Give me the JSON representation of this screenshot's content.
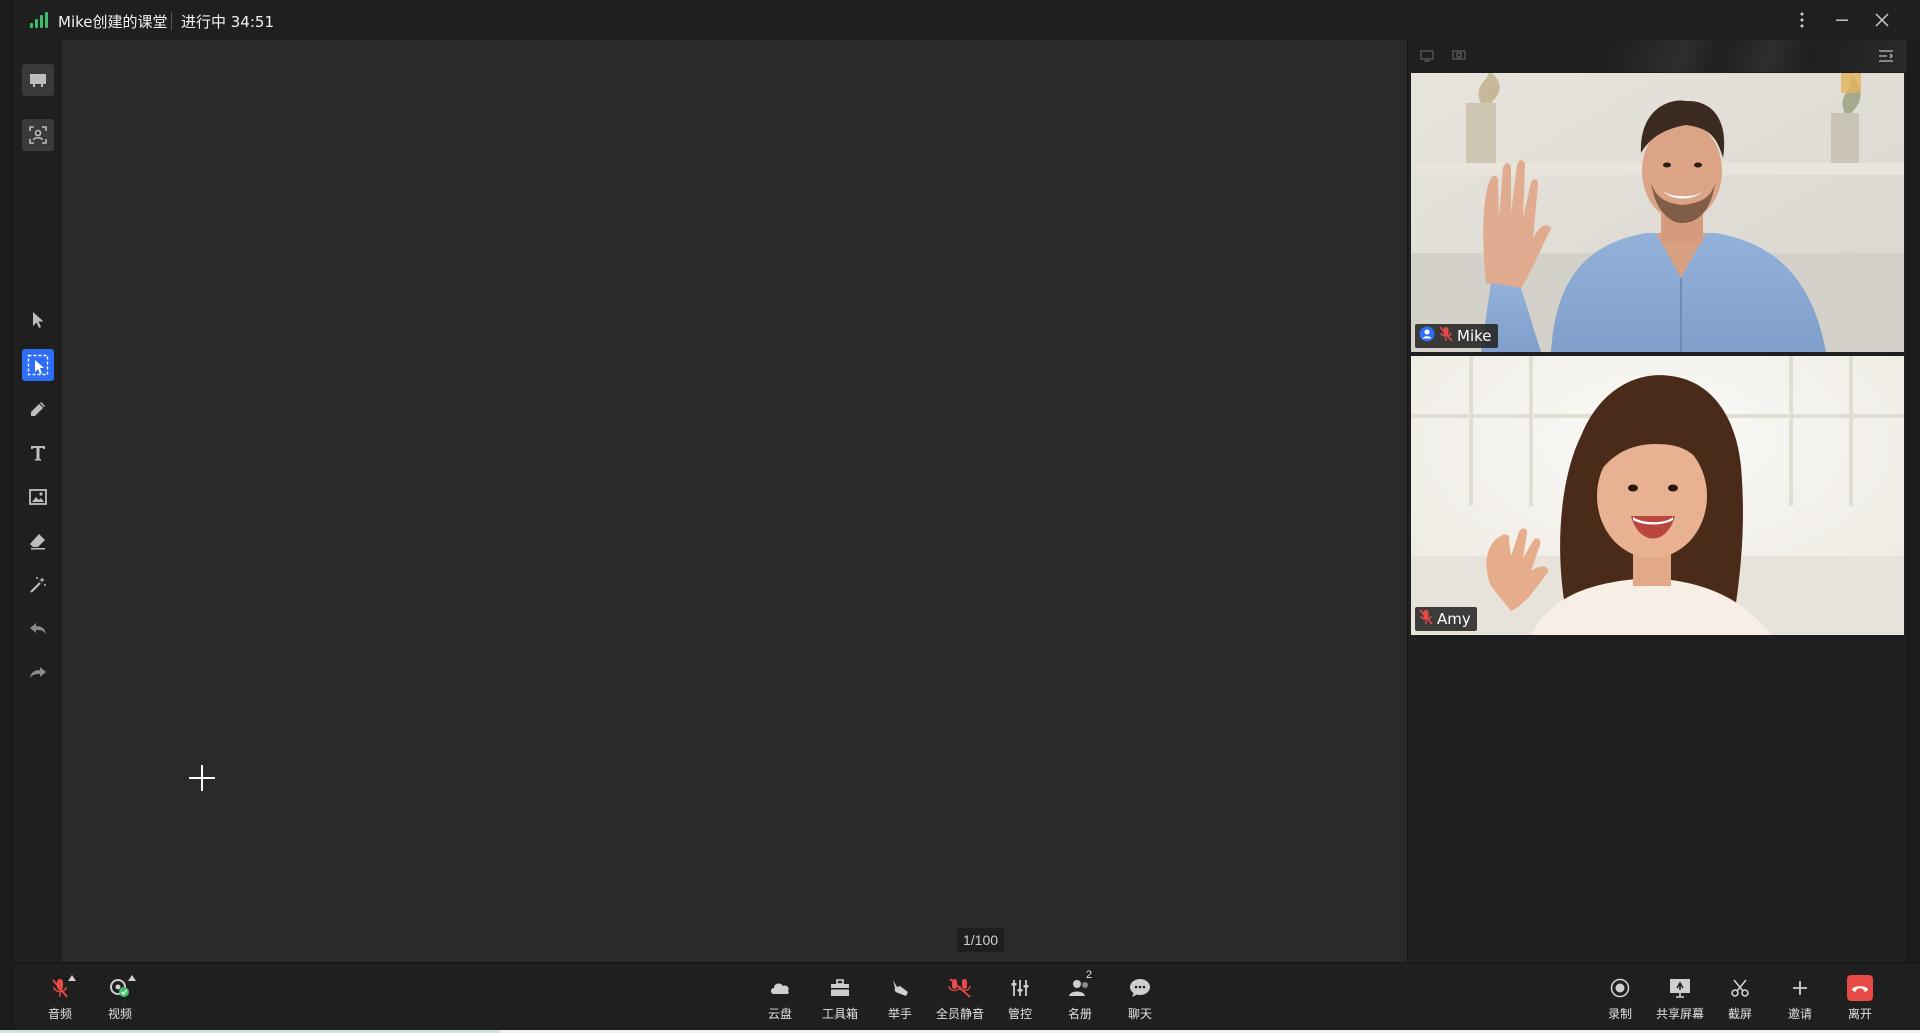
{
  "titlebar": {
    "class_name": "Mike创建的课堂",
    "status": "进行中 34:51",
    "icons": [
      "signal-icon",
      "more-vertical-icon",
      "minimize-icon",
      "close-icon"
    ]
  },
  "colors": {
    "accent": "#2e6df6",
    "leave": "#e84a47",
    "signal": "#3fbf6a",
    "board": "#2a2a2a"
  },
  "left_tools": [
    {
      "name": "courseware-icon"
    },
    {
      "name": "screenshot-icon"
    },
    {
      "name": "pointer-icon"
    },
    {
      "name": "select-icon",
      "active": true
    },
    {
      "name": "pen-icon"
    },
    {
      "name": "text-icon"
    },
    {
      "name": "image-icon"
    },
    {
      "name": "eraser-icon"
    },
    {
      "name": "laser-icon"
    },
    {
      "name": "undo-icon"
    },
    {
      "name": "redo-icon"
    }
  ],
  "board": {
    "page_indicator": "1/100"
  },
  "videos": [
    {
      "name": "Mike",
      "host": true,
      "muted": true
    },
    {
      "name": "Amy",
      "host": false,
      "muted": true
    }
  ],
  "toolbar": {
    "audio_label": "音频",
    "video_label": "视频",
    "cloud_label": "云盘",
    "toolbox_label": "工具箱",
    "raise_hand_label": "举手",
    "mute_all_label": "全员静音",
    "control_label": "管控",
    "roster_label": "名册",
    "roster_count": "2",
    "chat_label": "聊天",
    "record_label": "录制",
    "share_screen_label": "共享屏幕",
    "snip_label": "截屏",
    "invite_label": "邀请",
    "leave_label": "离开"
  }
}
